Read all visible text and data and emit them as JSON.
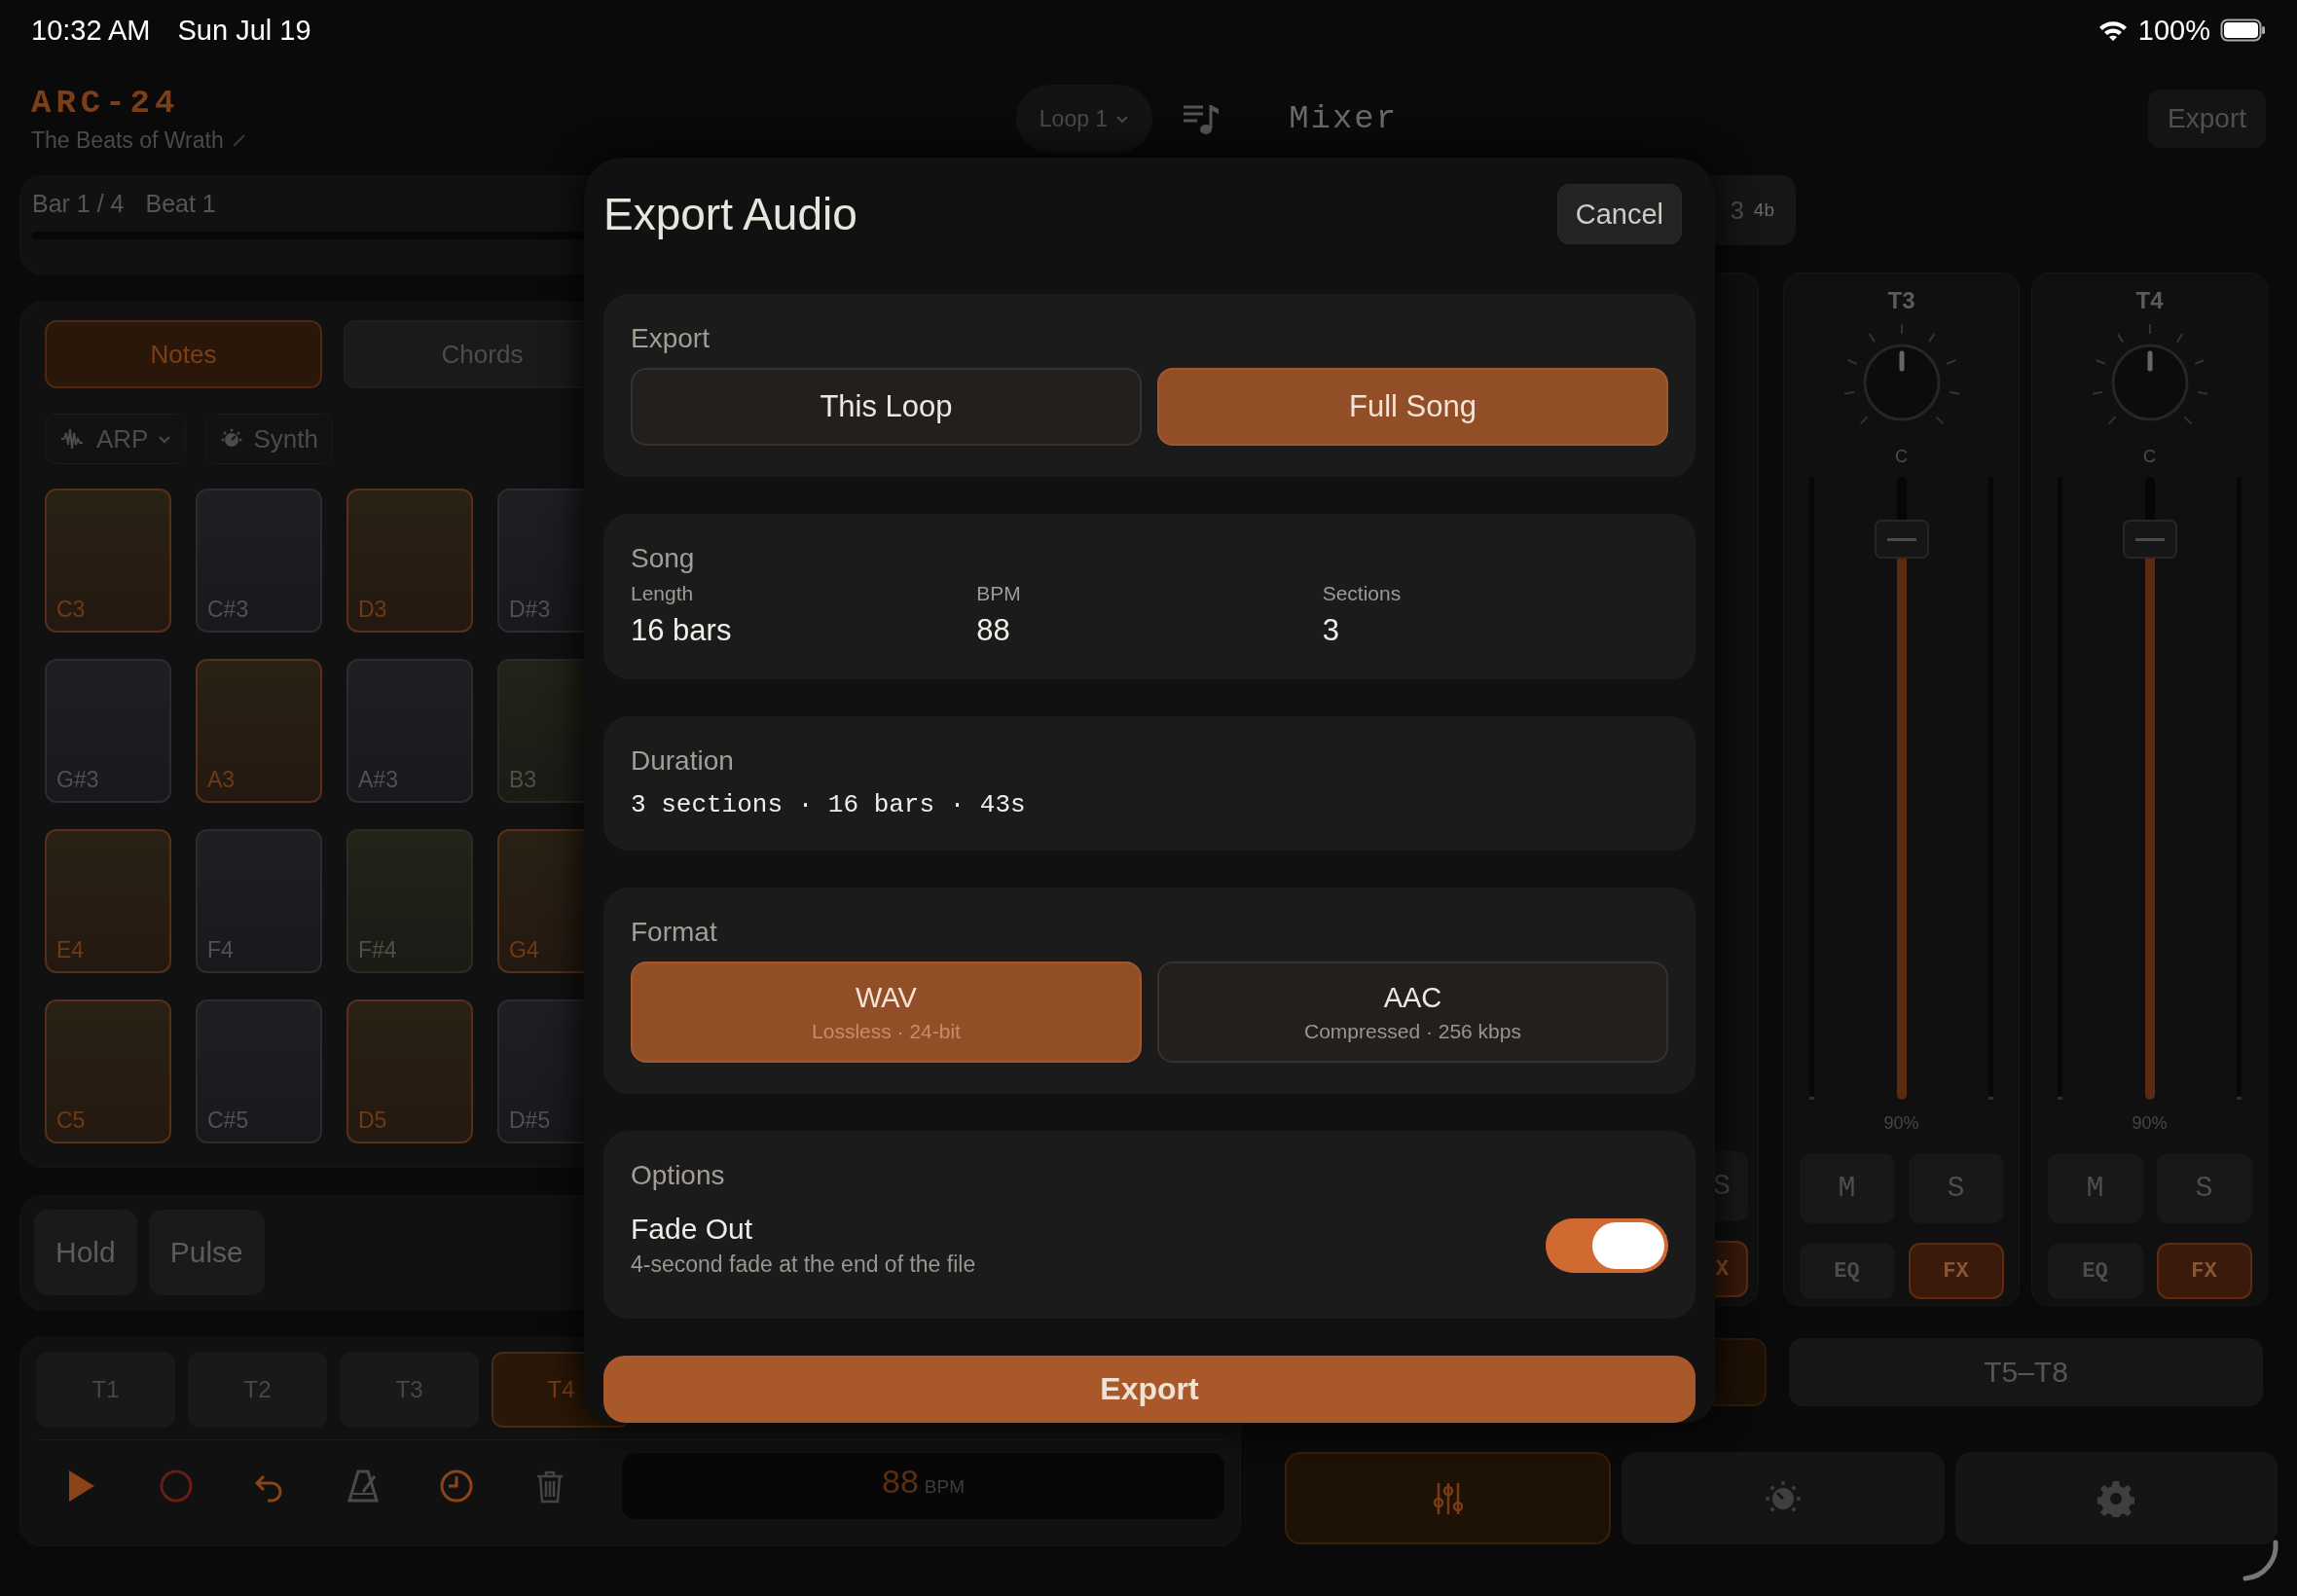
{
  "status_bar": {
    "time": "10:32 AM",
    "date": "Sun Jul 19",
    "battery": "100%"
  },
  "header": {
    "app_name": "ARC-24",
    "project": "The Beats of Wrath",
    "loop_menu": "Loop 1",
    "view_title": "Mixer",
    "export_button": "Export"
  },
  "position": {
    "bar": "Bar 1 / 4",
    "beat": "Beat 1"
  },
  "loop_chip": {
    "name": "3",
    "length": "4b"
  },
  "mode_tabs": [
    {
      "label": "Notes",
      "selected": true
    },
    {
      "label": "Chords",
      "selected": false
    }
  ],
  "instrument": {
    "pattern": "ARP",
    "sound": "Synth"
  },
  "pads": [
    {
      "note": "C3",
      "kind": "lit"
    },
    {
      "note": "C#3",
      "kind": "dark"
    },
    {
      "note": "D3",
      "kind": "lit"
    },
    {
      "note": "D#3",
      "kind": "dark"
    },
    {
      "note": "G#3",
      "kind": "dark"
    },
    {
      "note": "A3",
      "kind": "lit"
    },
    {
      "note": "A#3",
      "kind": "dark"
    },
    {
      "note": "B3",
      "kind": "dim"
    },
    {
      "note": "E4",
      "kind": "lit"
    },
    {
      "note": "F4",
      "kind": "dark"
    },
    {
      "note": "F#4",
      "kind": "dim"
    },
    {
      "note": "G4",
      "kind": "lit"
    },
    {
      "note": "C5",
      "kind": "lit"
    },
    {
      "note": "C#5",
      "kind": "dark"
    },
    {
      "note": "D5",
      "kind": "lit"
    },
    {
      "note": "D#5",
      "kind": "dark"
    }
  ],
  "performance_buttons": [
    "Hold",
    "Pulse"
  ],
  "tracks": [
    {
      "label": "T1",
      "selected": false
    },
    {
      "label": "T2",
      "selected": false
    },
    {
      "label": "T3",
      "selected": false
    },
    {
      "label": "T4",
      "selected": true
    }
  ],
  "tempo": {
    "value": "88",
    "unit": "BPM"
  },
  "mixer": {
    "clipped_strip": {
      "solo": "S",
      "fx": "X",
      "fx_on": true
    },
    "strips": [
      {
        "name": "T3",
        "pan": "C",
        "level": 0.9,
        "reading": "90%",
        "mute": "M",
        "muted": false,
        "solo": "S",
        "soloed": false,
        "eq": "EQ",
        "eq_on": false,
        "fx": "FX",
        "fx_on": true
      },
      {
        "name": "T4",
        "pan": "C",
        "level": 0.9,
        "reading": "90%",
        "mute": "M",
        "muted": false,
        "solo": "S",
        "soloed": false,
        "eq": "EQ",
        "eq_on": false,
        "fx": "FX",
        "fx_on": true
      }
    ]
  },
  "track_banks": [
    {
      "selected": true
    },
    {
      "label": "T5–T8",
      "selected": false
    }
  ],
  "bottom_tabs": [
    {
      "kind": "mixer",
      "selected": true
    },
    {
      "kind": "knob",
      "selected": false
    },
    {
      "kind": "settings",
      "selected": false
    }
  ],
  "dialog": {
    "title": "Export Audio",
    "cancel": "Cancel",
    "scope": {
      "label": "Export",
      "options": [
        {
          "label": "This Loop",
          "selected": false
        },
        {
          "label": "Full Song",
          "selected": true
        }
      ]
    },
    "song": {
      "label": "Song",
      "stats": [
        {
          "label": "Length",
          "value": "16 bars"
        },
        {
          "label": "BPM",
          "value": "88"
        },
        {
          "label": "Sections",
          "value": "3"
        }
      ]
    },
    "duration": {
      "label": "Duration",
      "summary": "3 sections · 16 bars · 43s"
    },
    "format": {
      "label": "Format",
      "options": [
        {
          "name": "WAV",
          "detail": "Lossless · 24-bit",
          "selected": true
        },
        {
          "name": "AAC",
          "detail": "Compressed · 256 kbps",
          "selected": false
        }
      ]
    },
    "options": {
      "label": "Options",
      "items": [
        {
          "title": "Fade Out",
          "description": "4-second fade at the end of the file",
          "on": true
        }
      ]
    },
    "export_button": "Export"
  }
}
